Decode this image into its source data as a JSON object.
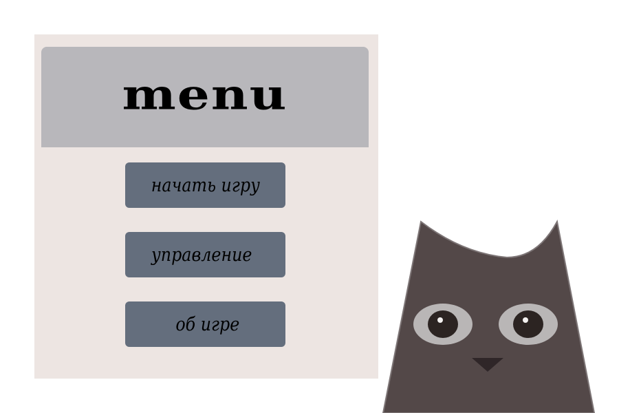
{
  "menu": {
    "title": "menu",
    "buttons": [
      {
        "id": "start",
        "label": "начать игру"
      },
      {
        "id": "controls",
        "label": "управление"
      },
      {
        "id": "about",
        "label": "об игре"
      }
    ]
  },
  "colors": {
    "panel_background": "#ede5e2",
    "header_background": "#b8b7bb",
    "button_background": "#646e7d",
    "owl_body": "#534848",
    "owl_eye_ring": "#b9b6b6",
    "owl_pupil": "#2c2422",
    "owl_beak": "#2f2628"
  },
  "decorations": {
    "mascot": "owl-icon"
  }
}
